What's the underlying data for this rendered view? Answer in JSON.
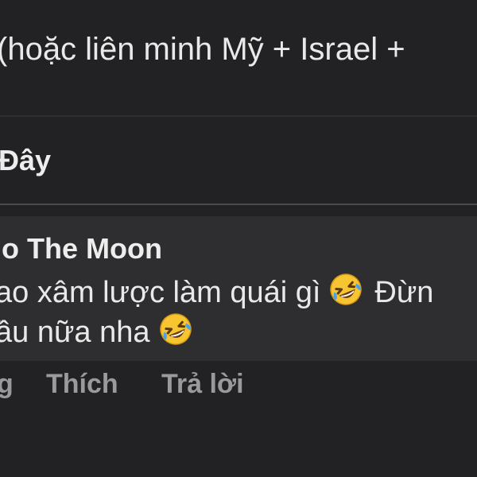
{
  "post": {
    "text": "(hoặc liên minh Mỹ + Israel +"
  },
  "context": {
    "label": "Đây"
  },
  "comment": {
    "author": "o The Moon",
    "line1": "ao xâm lược làm quái gì",
    "line1_tail": "Đừn",
    "line2": "ầu nữa nha",
    "emoji": "rolling-on-floor-laughing"
  },
  "actions": {
    "time": "g",
    "like": "Thích",
    "reply": "Trả lời"
  },
  "colors": {
    "background": "#222224",
    "comment_bubble": "#2e2e30",
    "text": "#ededed",
    "action_text": "#9a9a9c",
    "emoji_face": "#f7c531",
    "emoji_tear": "#4aa3e8"
  }
}
